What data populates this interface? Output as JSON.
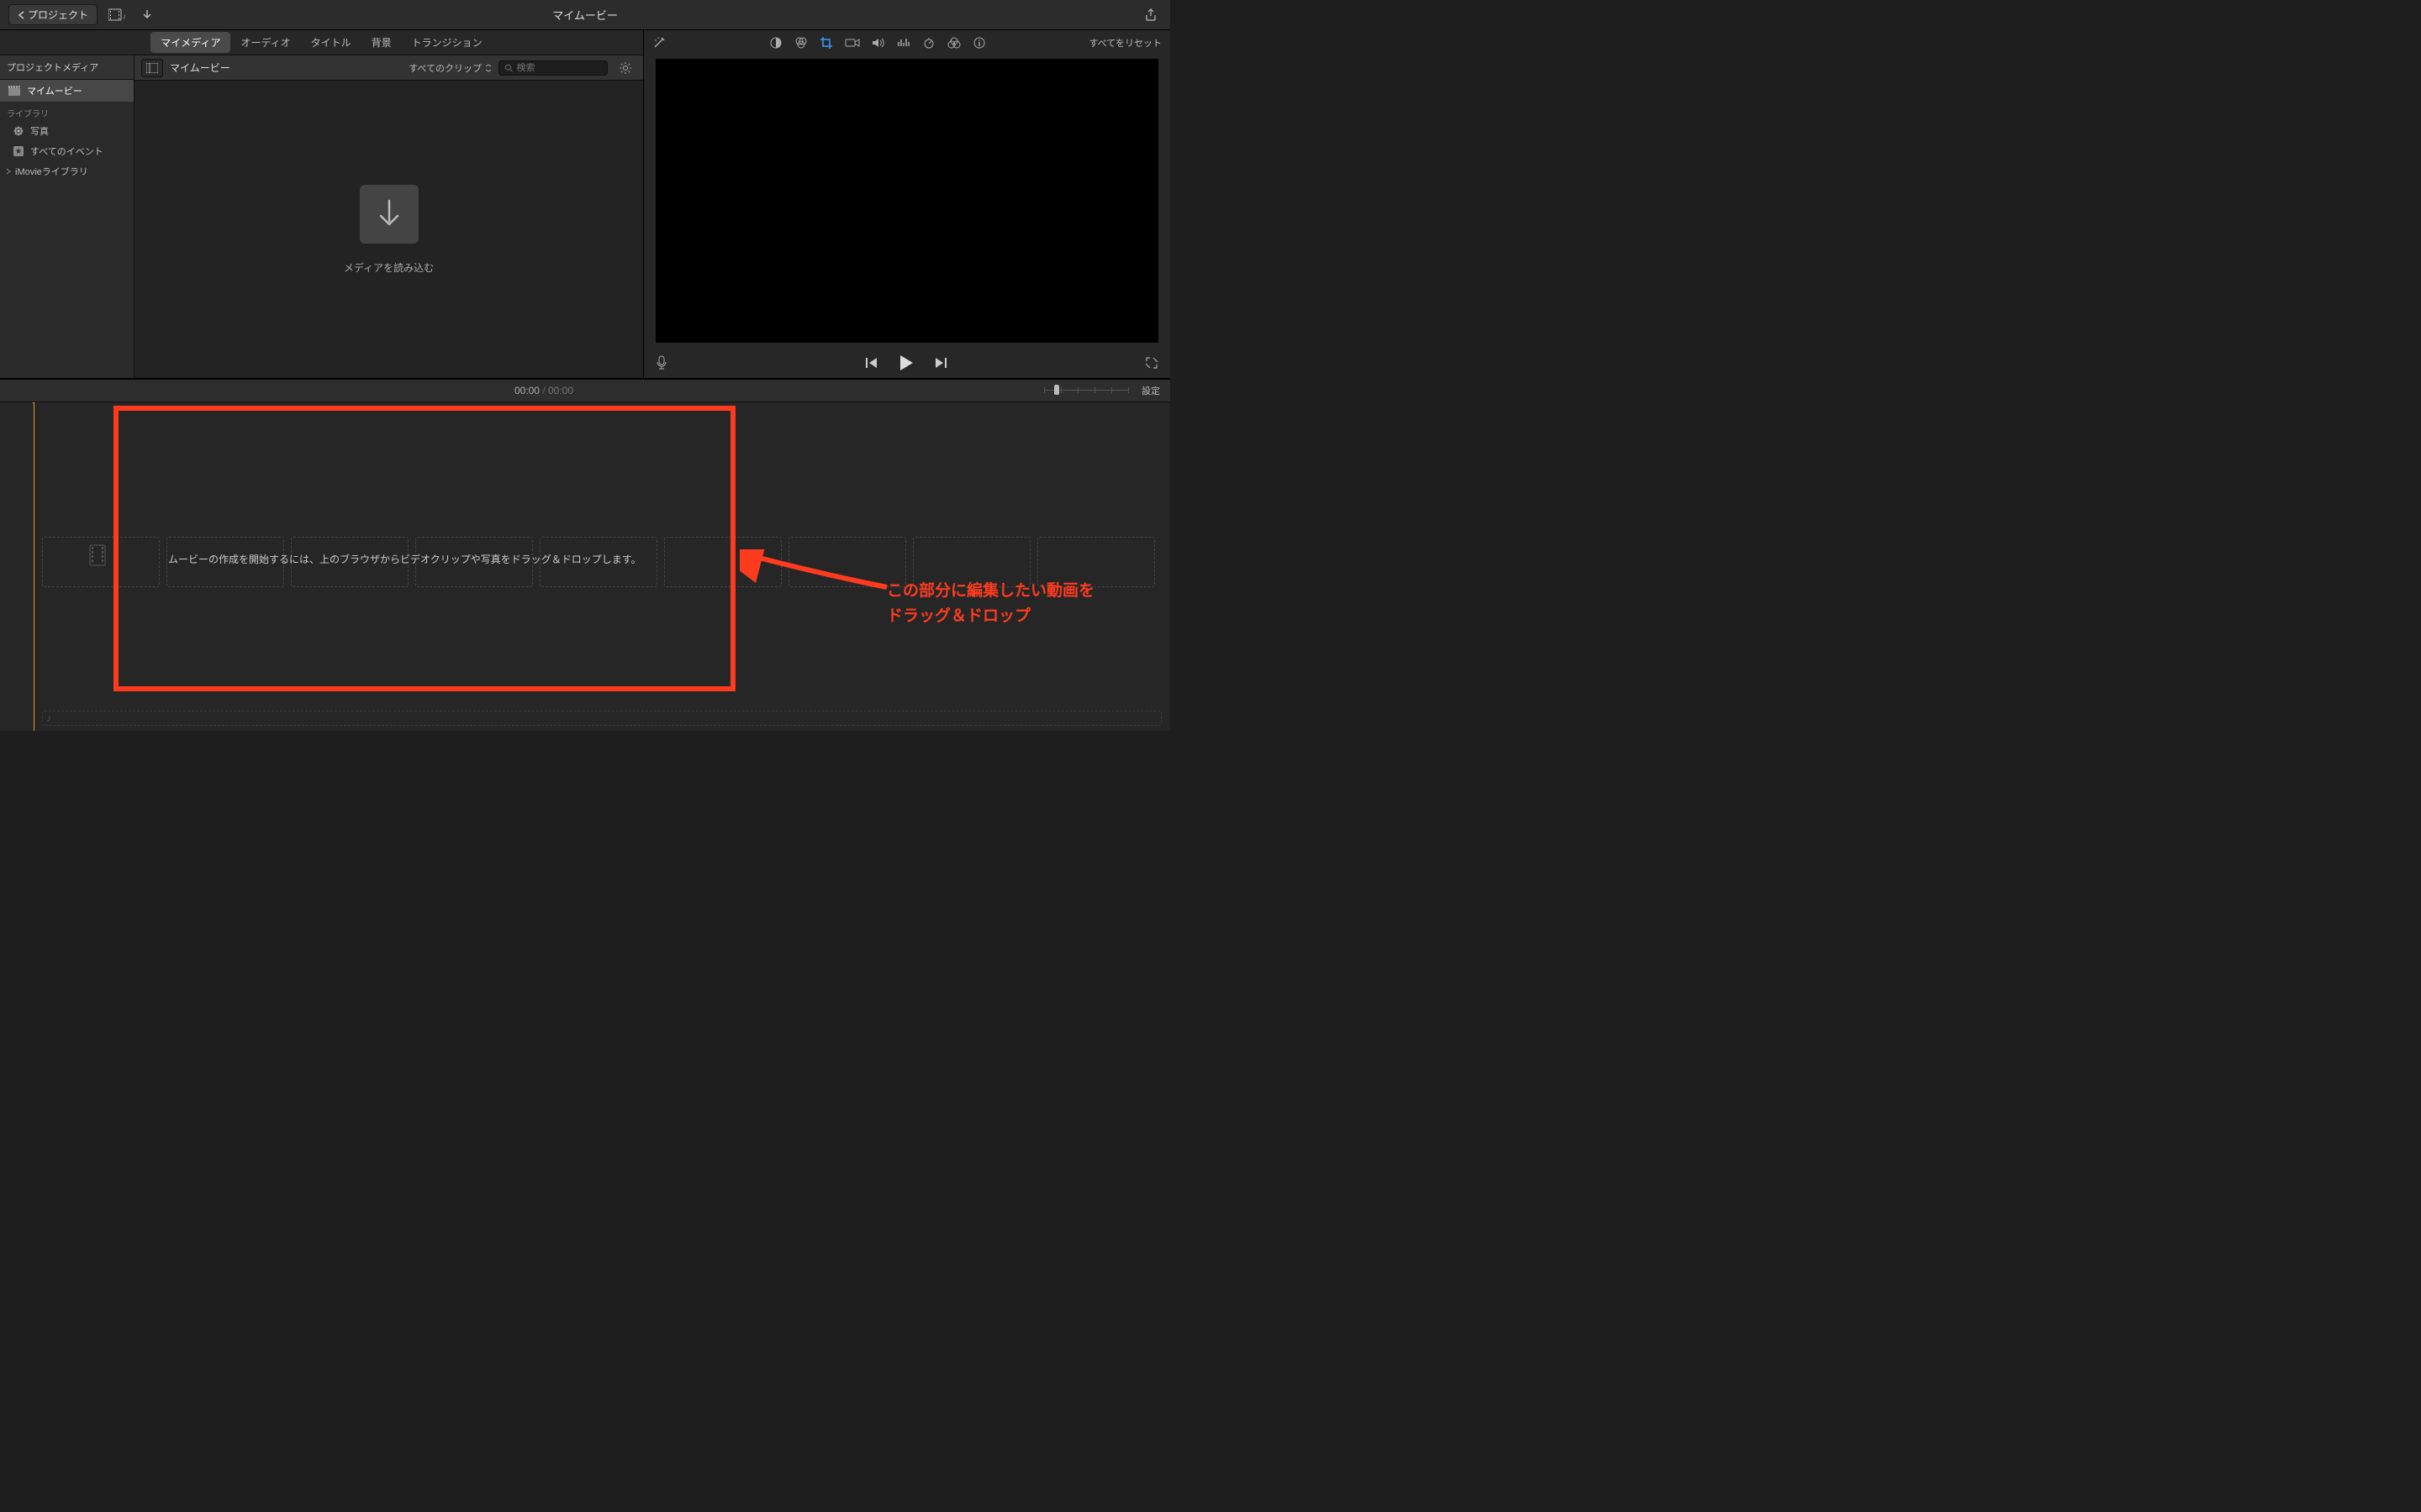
{
  "top": {
    "back_label": "プロジェクト",
    "title": "マイムービー"
  },
  "tabs": {
    "media": "マイメディア",
    "audio": "オーディオ",
    "titles": "タイトル",
    "backgrounds": "背景",
    "transitions": "トランジション"
  },
  "sidebar": {
    "project_media_header": "プロジェクトメディア",
    "my_movie": "マイムービー",
    "library_header": "ライブラリ",
    "photos": "写真",
    "all_events": "すべてのイベント",
    "imovie_library": "iMovieライブラリ"
  },
  "media": {
    "title": "マイムービー",
    "filter": "すべてのクリップ",
    "search_placeholder": "検索",
    "import_label": "メディアを読み込む"
  },
  "inspector": {
    "reset": "すべてをリセット"
  },
  "timeline": {
    "time_current": "00:00",
    "time_total": "00:00",
    "settings": "設定",
    "drop_hint": "ムービーの作成を開始するには、上のブラウザからビデオクリップや写真をドラッグ＆ドロップします。"
  },
  "annotation": {
    "line1": "この部分に編集したい動画を",
    "line2": "ドラッグ＆ドロップ"
  }
}
